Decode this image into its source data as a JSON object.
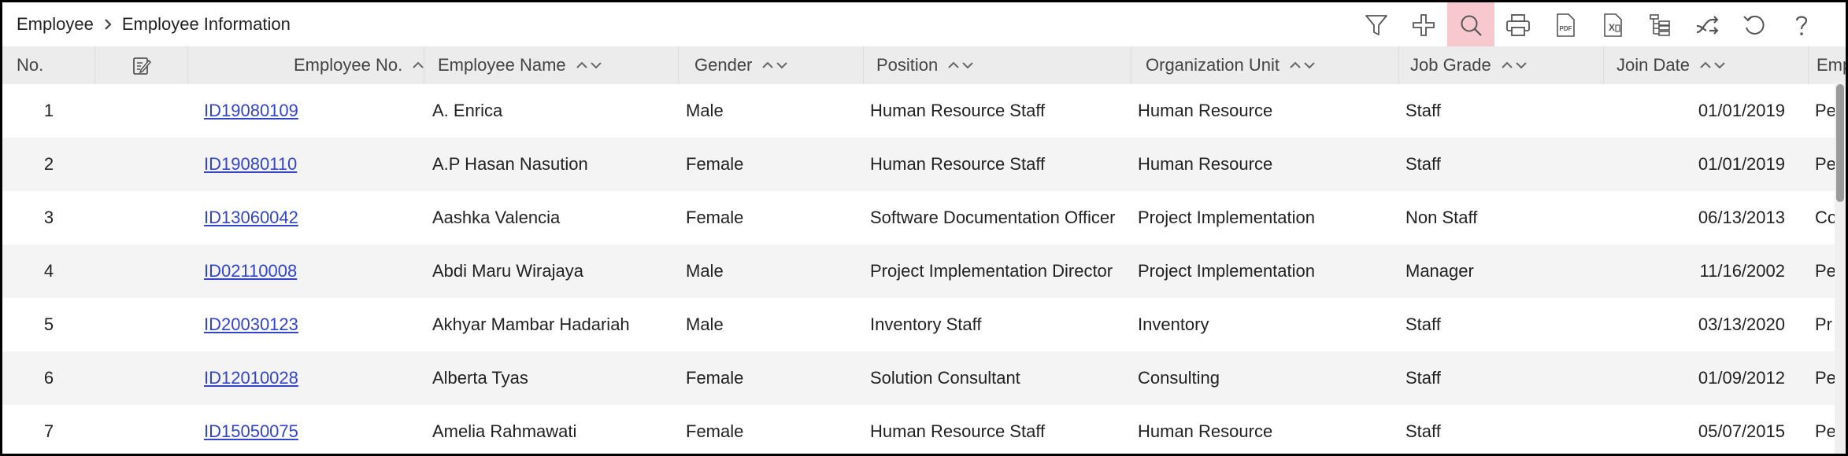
{
  "breadcrumb": {
    "root": "Employee",
    "current": "Employee Information"
  },
  "toolbar": {
    "tools": [
      {
        "icon": "filter-icon"
      },
      {
        "icon": "add-icon"
      },
      {
        "icon": "search-icon",
        "active": true
      },
      {
        "icon": "print-icon"
      },
      {
        "icon": "pdf-icon"
      },
      {
        "icon": "excel-icon"
      },
      {
        "icon": "tree-icon"
      },
      {
        "icon": "shuffle-icon"
      },
      {
        "icon": "refresh-icon"
      },
      {
        "icon": "help-icon"
      }
    ],
    "active_color": "#f7c9ce"
  },
  "table": {
    "columns": {
      "no": "No.",
      "employee_no": "Employee No.",
      "employee_name": "Employee Name",
      "gender": "Gender",
      "position": "Position",
      "org_unit": "Organization Unit",
      "job_grade": "Job Grade",
      "join_date": "Join Date",
      "emp": "Emp"
    },
    "rows": [
      {
        "no": "1",
        "employee_no": "ID19080109",
        "employee_name": "A. Enrica",
        "gender": "Male",
        "position": "Human Resource Staff",
        "org_unit": "Human Resource",
        "job_grade": "Staff",
        "join_date": "01/01/2019",
        "emp": "Pe"
      },
      {
        "no": "2",
        "employee_no": "ID19080110",
        "employee_name": "A.P Hasan Nasution",
        "gender": "Female",
        "position": "Human Resource Staff",
        "org_unit": "Human Resource",
        "job_grade": "Staff",
        "join_date": "01/01/2019",
        "emp": "Pe"
      },
      {
        "no": "3",
        "employee_no": "ID13060042",
        "employee_name": "Aashka Valencia",
        "gender": "Female",
        "position": "Software Documentation Officer",
        "org_unit": "Project Implementation",
        "job_grade": "Non Staff",
        "join_date": "06/13/2013",
        "emp": "Co"
      },
      {
        "no": "4",
        "employee_no": "ID02110008",
        "employee_name": "Abdi Maru Wirajaya",
        "gender": "Male",
        "position": "Project Implementation Director",
        "org_unit": "Project Implementation",
        "job_grade": "Manager",
        "join_date": "11/16/2002",
        "emp": "Pe"
      },
      {
        "no": "5",
        "employee_no": "ID20030123",
        "employee_name": "Akhyar Mambar Hadariah",
        "gender": "Male",
        "position": "Inventory Staff",
        "org_unit": "Inventory",
        "job_grade": "Staff",
        "join_date": "03/13/2020",
        "emp": "Pr"
      },
      {
        "no": "6",
        "employee_no": "ID12010028",
        "employee_name": "Alberta Tyas",
        "gender": "Female",
        "position": "Solution Consultant",
        "org_unit": "Consulting",
        "job_grade": "Staff",
        "join_date": "01/09/2012",
        "emp": "Pe"
      },
      {
        "no": "7",
        "employee_no": "ID15050075",
        "employee_name": "Amelia Rahmawati",
        "gender": "Female",
        "position": "Human Resource Staff",
        "org_unit": "Human Resource",
        "job_grade": "Staff",
        "join_date": "05/07/2015",
        "emp": "Pe"
      }
    ]
  }
}
